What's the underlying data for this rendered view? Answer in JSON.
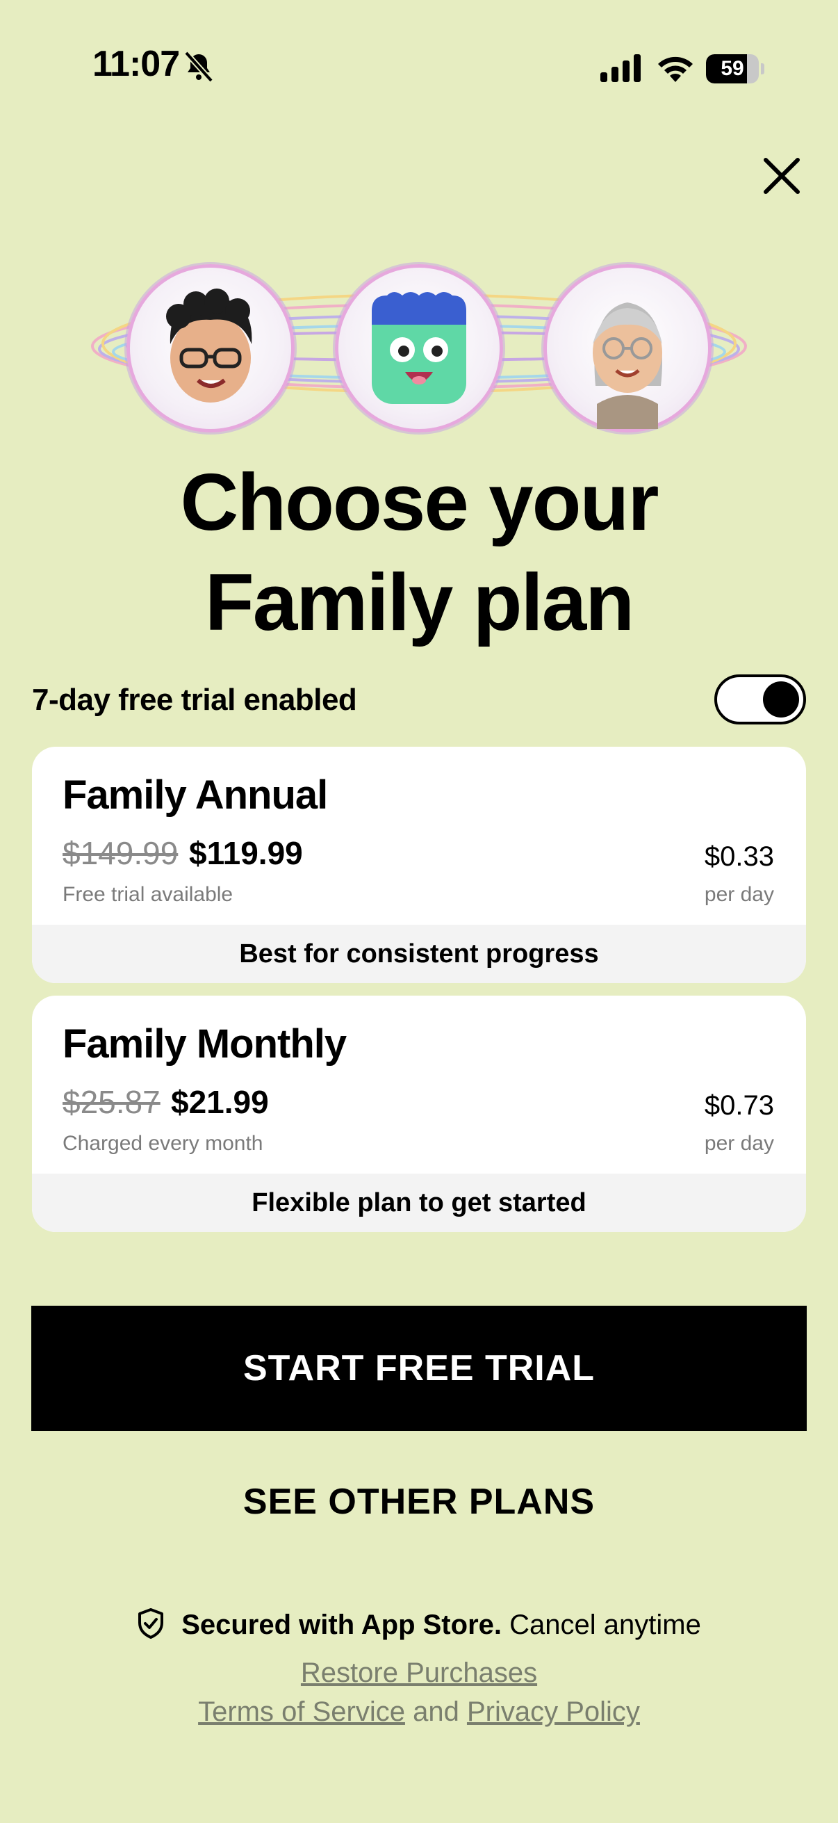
{
  "status_bar": {
    "time": "11:07",
    "battery_level": "59",
    "icons": [
      "bell-slash-icon",
      "cellular-signal-icon",
      "wifi-icon",
      "battery-icon"
    ]
  },
  "close": {
    "icon": "close-icon"
  },
  "headline": {
    "line1": "Choose your",
    "line2": "Family plan"
  },
  "trial": {
    "label": "7-day free trial enabled",
    "enabled": true
  },
  "plans": [
    {
      "name": "Family Annual",
      "old_price": "$149.99",
      "price": "$119.99",
      "note": "Free trial available",
      "daily_price": "$0.33",
      "per": "per day",
      "footer": "Best for consistent progress"
    },
    {
      "name": "Family Monthly",
      "old_price": "$25.87",
      "price": "$21.99",
      "note": "Charged every month",
      "daily_price": "$0.73",
      "per": "per day",
      "footer": "Flexible plan to get started"
    }
  ],
  "cta": {
    "label": "START FREE TRIAL"
  },
  "secondary": {
    "label": "SEE OTHER PLANS"
  },
  "footer": {
    "secured_bold": "Secured with App Store.",
    "secured_rest": "Cancel anytime",
    "restore": "Restore Purchases",
    "terms": "Terms of Service",
    "and": "and",
    "privacy": "Privacy Policy"
  },
  "colors": {
    "background": "#e6edc1",
    "card": "#ffffff",
    "card_footer": "#f3f3f3",
    "cta": "#000000"
  }
}
